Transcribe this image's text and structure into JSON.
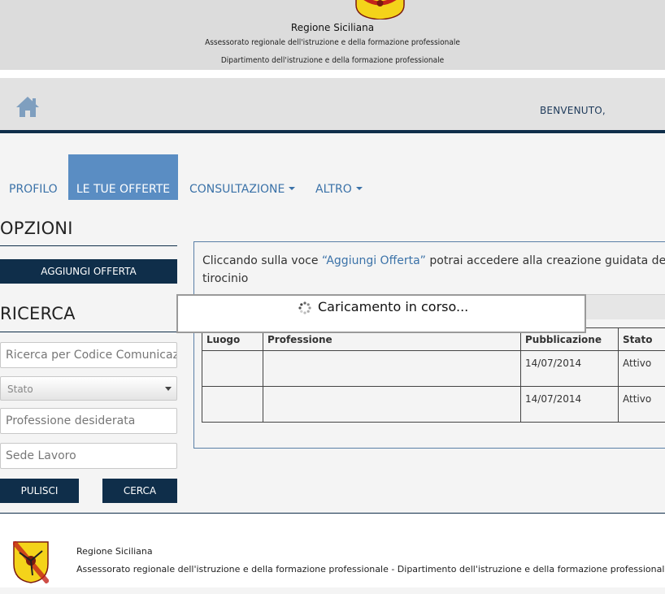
{
  "header": {
    "title": "Regione Siciliana",
    "subtitle1": "Assessorato regionale dell'istruzione e della formazione professionale",
    "subtitle2": "Dipartimento dell'istruzione e della formazione professionale",
    "welcome": "BENVENUTO,"
  },
  "nav": {
    "tabs": [
      {
        "label": "PROFILO",
        "active": false
      },
      {
        "label": "LE TUE OFFERTE",
        "active": true
      },
      {
        "label": "CONSULTAZIONE",
        "dropdown": true
      },
      {
        "label": "ALTRO",
        "dropdown": true
      }
    ]
  },
  "sidebar": {
    "options_title": "OPZIONI",
    "add_offer_button": "AGGIUNGI OFFERTA",
    "search_title": "RICERCA",
    "code_placeholder": "Ricerca per Codice Comunicazione",
    "status_select": "Stato",
    "profession_placeholder": "Professione desiderata",
    "location_placeholder": "Sede Lavoro",
    "clear_button": "PULISCI",
    "search_button": "CERCA"
  },
  "content": {
    "info_prefix": "Cliccando sulla voce ",
    "info_link": "“Aggiungi Offerta”",
    "info_suffix": " potrai accedere alla creazione guidata della t",
    "info_line2": "tirocinio",
    "table": {
      "headers": [
        "Luogo",
        "Professione",
        "Pubblicazione",
        "Stato"
      ],
      "rows": [
        [
          "",
          "",
          "14/07/2014",
          "Attivo"
        ],
        [
          "",
          "",
          "14/07/2014",
          "Attivo"
        ]
      ]
    }
  },
  "loading": {
    "text": "Caricamento in corso..."
  },
  "footer": {
    "title": "Regione Siciliana",
    "subtitle": "Assessorato regionale dell'istruzione e della formazione professionale - Dipartimento dell'istruzione e della formazione professionale"
  },
  "colors": {
    "dark_navy": "#0f2e4a",
    "active_tab": "#5a8dc3",
    "link_blue": "#3b72a8"
  }
}
